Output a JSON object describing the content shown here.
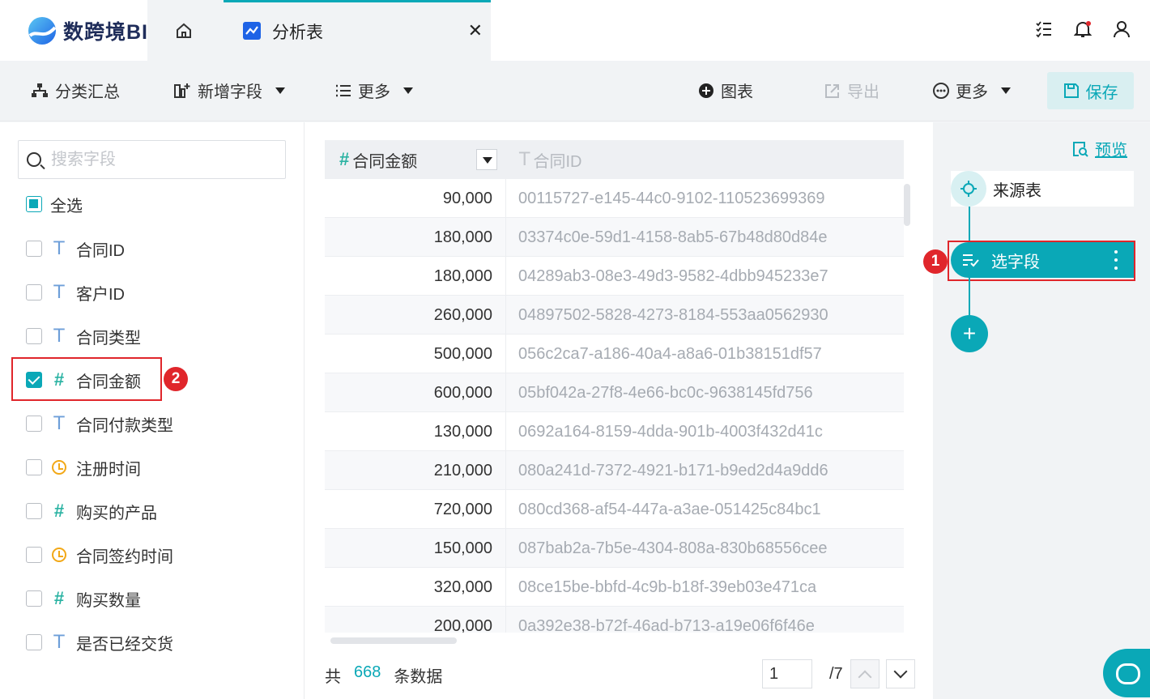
{
  "app": {
    "name": "数跨境BI"
  },
  "tabs": [
    {
      "label": "分析表"
    }
  ],
  "toolbar": {
    "group_label": "分类汇总",
    "add_field_label": "新增字段",
    "more_label_1": "更多",
    "chart_label": "图表",
    "export_label": "导出",
    "more_label_2": "更多",
    "save_label": "保存"
  },
  "fields_panel": {
    "search_placeholder": "搜索字段",
    "select_all_label": "全选",
    "fields": [
      {
        "name": "合同ID",
        "type": "text",
        "checked": false
      },
      {
        "name": "客户ID",
        "type": "text",
        "checked": false
      },
      {
        "name": "合同类型",
        "type": "text",
        "checked": false
      },
      {
        "name": "合同金额",
        "type": "number",
        "checked": true
      },
      {
        "name": "合同付款类型",
        "type": "text",
        "checked": false
      },
      {
        "name": "注册时间",
        "type": "date",
        "checked": false
      },
      {
        "name": "购买的产品",
        "type": "number",
        "checked": false
      },
      {
        "name": "合同签约时间",
        "type": "date",
        "checked": false
      },
      {
        "name": "购买数量",
        "type": "number",
        "checked": false
      },
      {
        "name": "是否已经交货",
        "type": "text",
        "checked": false
      }
    ]
  },
  "table": {
    "columns": [
      "合同金额",
      "合同ID"
    ],
    "rows": [
      [
        "90,000",
        "00115727-e145-44c0-9102-110523699369"
      ],
      [
        "180,000",
        "03374c0e-59d1-4158-8ab5-67b48d80d84e"
      ],
      [
        "180,000",
        "04289ab3-08e3-49d3-9582-4dbb945233e7"
      ],
      [
        "260,000",
        "04897502-5828-4273-8184-553aa0562930"
      ],
      [
        "500,000",
        "056c2ca7-a186-40a4-a8a6-01b38151df57"
      ],
      [
        "600,000",
        "05bf042a-27f8-4e66-bc0c-9638145fd756"
      ],
      [
        "130,000",
        "0692a164-8159-4dda-901b-4003f432d41c"
      ],
      [
        "210,000",
        "080a241d-7372-4921-b171-b9ed2d4a9dd6"
      ],
      [
        "720,000",
        "080cd368-af54-447a-a3ae-051425c84bc1"
      ],
      [
        "150,000",
        "087bab2a-7b5e-4304-808a-830b68556cee"
      ],
      [
        "320,000",
        "08ce15be-bbfd-4c9b-b18f-39eb03e471ca"
      ],
      [
        "200,000",
        "0a392e38-b72f-46ad-b713-a19e06f6f46e"
      ]
    ],
    "footer": {
      "prefix": "共",
      "count": "668",
      "suffix": "条数据"
    },
    "pager": {
      "current": "1",
      "total": "/7"
    }
  },
  "flow": {
    "preview_label": "预览",
    "source_label": "来源表",
    "select_label": "选字段"
  },
  "annotations": [
    "1",
    "2"
  ],
  "colors": {
    "accent": "#0aa8b7",
    "highlight": "#e0262b",
    "brand": "#1e63e6"
  },
  "icons": {
    "home": "home-icon",
    "chart_tab": "chart-icon",
    "close": "close-icon",
    "tasks": "checklist-icon",
    "bell": "bell-icon",
    "user": "user-icon",
    "group": "tree-icon",
    "add_field": "add-column-icon",
    "list": "list-icon",
    "plus_circle": "plus-circle-icon",
    "export": "export-icon",
    "more": "more-circle-icon",
    "save": "save-icon",
    "search": "search-icon",
    "preview": "preview-icon",
    "source": "crosshair-icon",
    "select": "select-fields-icon",
    "support": "headset-icon"
  }
}
